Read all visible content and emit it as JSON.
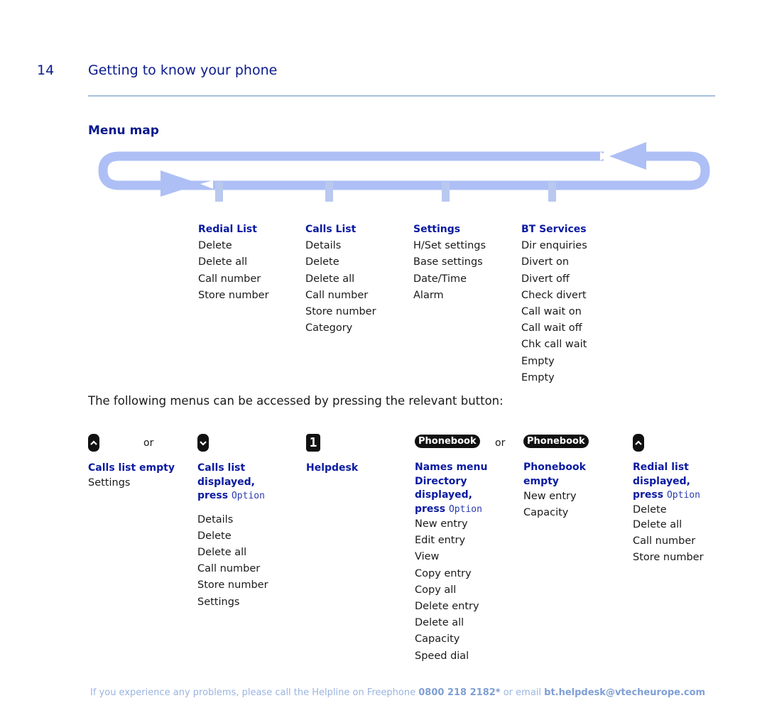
{
  "header": {
    "page_number": "14",
    "chapter_title": "Getting to know your phone"
  },
  "section": {
    "title": "Menu map"
  },
  "menu_loop": {
    "color": "#aebff5",
    "columns": [
      {
        "title": "Redial List",
        "items": [
          "Delete",
          "Delete all",
          "Call number",
          "Store number"
        ]
      },
      {
        "title": "Calls List",
        "items": [
          "Details",
          "Delete",
          "Delete all",
          "Call number",
          "Store number",
          "Category"
        ]
      },
      {
        "title": "Settings",
        "items": [
          "H/Set settings",
          "Base settings",
          "Date/Time",
          "Alarm"
        ]
      },
      {
        "title": "BT Services",
        "items": [
          "Dir enquiries",
          "Divert on",
          "Divert off",
          "Check divert",
          "Call wait on",
          "Call wait off",
          "Chk call wait",
          "Empty",
          "Empty"
        ]
      }
    ]
  },
  "intro_text": "The following menus can be accessed by pressing the relevant button:",
  "or_label": "or",
  "buttons": {
    "up_icon": "chevron-up-key",
    "down_icon": "chevron-down-key",
    "one_label": "1",
    "phonebook_label": "Phonebook"
  },
  "button_menus": [
    {
      "heading_lines": [
        "Calls list empty"
      ],
      "items": [
        "Settings"
      ]
    },
    {
      "heading_lines": [
        "Calls list",
        "displayed,"
      ],
      "press_label": "press",
      "option_label": "Option",
      "items": [
        "Details",
        "Delete",
        "Delete all",
        "Call number",
        "Store number",
        "Settings"
      ]
    },
    {
      "heading_lines": [
        "Helpdesk"
      ],
      "items": []
    },
    {
      "heading_lines": [
        "Names menu",
        "Directory",
        "displayed,"
      ],
      "press_label": "press",
      "option_label": "Option",
      "items": [
        "New entry",
        "Edit entry",
        "View",
        "Copy entry",
        "Copy all",
        "Delete entry",
        "Delete all",
        "Capacity",
        "Speed dial"
      ]
    },
    {
      "heading_lines": [
        "Phonebook",
        "empty"
      ],
      "items": [
        "New entry",
        "Capacity"
      ]
    },
    {
      "heading_lines": [
        "Redial list",
        "displayed,"
      ],
      "press_label": "press",
      "option_label": "Option",
      "items": [
        "Delete",
        "Delete all",
        "Call number",
        "Store number"
      ]
    }
  ],
  "footer": {
    "text_before": "If you experience any problems, please call the Helpline on Freephone ",
    "phone": "0800 218 2182*",
    "text_middle": " or email ",
    "email": "bt.helpdesk@vtecheurope.com"
  }
}
